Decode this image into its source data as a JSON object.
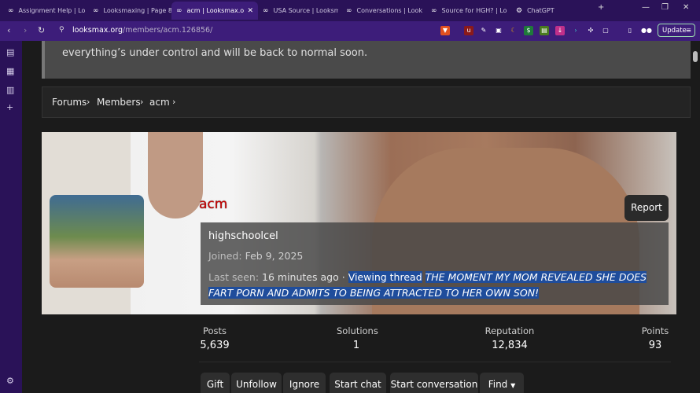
{
  "tabs": [
    {
      "label": "Assignment Help | Lo",
      "icon": "infinity-icon"
    },
    {
      "label": "Looksmaxing | Page 8",
      "icon": "infinity-icon"
    },
    {
      "label": "acm | Looksmax.o",
      "icon": "infinity-icon",
      "active": true
    },
    {
      "label": "USA Source | Looksm",
      "icon": "infinity-icon"
    },
    {
      "label": "Conversations | Look",
      "icon": "infinity-icon"
    },
    {
      "label": "Source for HGH? | Lo",
      "icon": "infinity-icon"
    },
    {
      "label": "ChatGPT",
      "icon": "chatgpt-icon"
    }
  ],
  "toolbar": {
    "url_host": "looksmax.org",
    "url_path": "/members/acm.126856/",
    "update_label": "Update"
  },
  "notice": {
    "text": "everything’s under control and will be back to normal soon."
  },
  "breadcrumb": [
    "Forums",
    "Members",
    "acm"
  ],
  "profile": {
    "username": "acm",
    "title": "highschoolcel",
    "joined_label": "Joined:",
    "joined_value": "Feb 9, 2025",
    "seen_label": "Last seen:",
    "seen_value": "16 minutes ago",
    "seen_sep": "·",
    "activity_prefix": "Viewing thread",
    "thread_title": "THE MOMENT MY MOM REVEALED SHE DOES FART PORN AND ADMITS TO BEING ATTRACTED TO HER OWN SON!",
    "report_label": "Report"
  },
  "stats": [
    {
      "label": "Posts",
      "value": "5,639"
    },
    {
      "label": "Solutions",
      "value": "1"
    },
    {
      "label": "Reputation",
      "value": "12,834"
    },
    {
      "label": "Points",
      "value": "93"
    }
  ],
  "actions": {
    "gift": "Gift",
    "unfollow": "Unfollow",
    "ignore": "Ignore",
    "start_chat": "Start chat",
    "start_conversation": "Start conversation",
    "find": "Find"
  },
  "colors": {
    "browser_frame": "#2a1258",
    "toolbar": "#3d1d7a",
    "username": "#cc0000",
    "selection": "#1f4d9c"
  }
}
